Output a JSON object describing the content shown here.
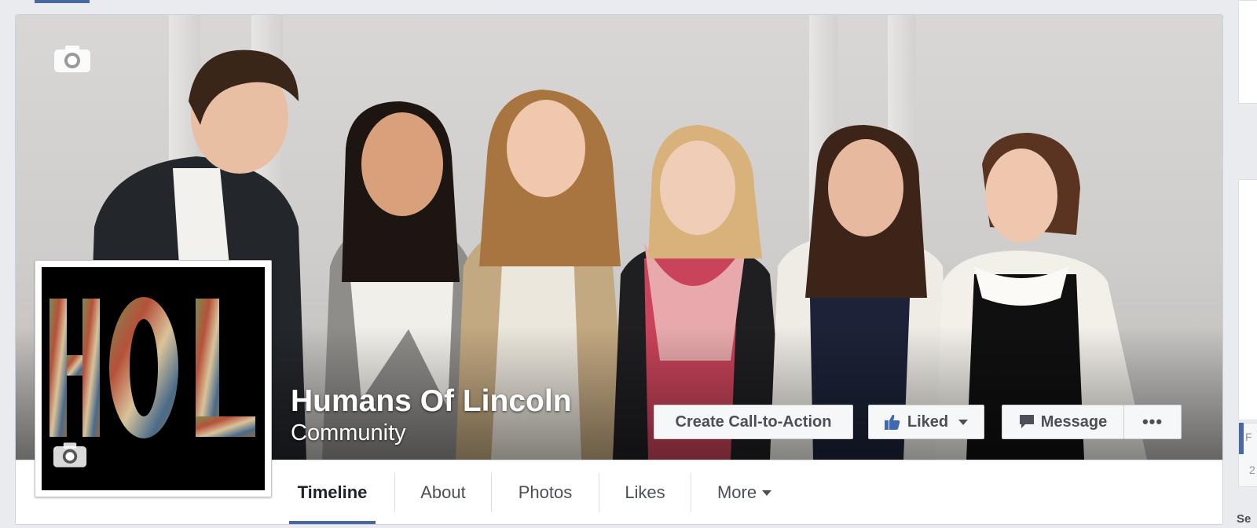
{
  "page": {
    "name": "Humans Of Lincoln",
    "category": "Community"
  },
  "profile_picture": {
    "logo_text": "HOL"
  },
  "cover_actions": {
    "cta_label": "Create Call-to-Action",
    "liked_label": "Liked",
    "message_label": "Message",
    "more_dots": "•••"
  },
  "tabs": [
    {
      "label": "Timeline",
      "active": true
    },
    {
      "label": "About",
      "active": false
    },
    {
      "label": "Photos",
      "active": false
    },
    {
      "label": "Likes",
      "active": false
    },
    {
      "label": "More",
      "active": false
    }
  ],
  "right_column": {
    "partial_text_1": "F",
    "partial_text_2": "2",
    "partial_text_3": "Se"
  },
  "colors": {
    "accent": "#4b67a1",
    "like_blue": "#4267b2",
    "background": "#e9ebee"
  },
  "icons": {
    "cover_camera": "camera-icon",
    "profile_camera": "camera-icon",
    "liked": "thumbs-up-icon",
    "liked_dropdown": "caret-down-icon",
    "message": "speech-bubble-icon",
    "more_tab": "caret-down-icon"
  }
}
